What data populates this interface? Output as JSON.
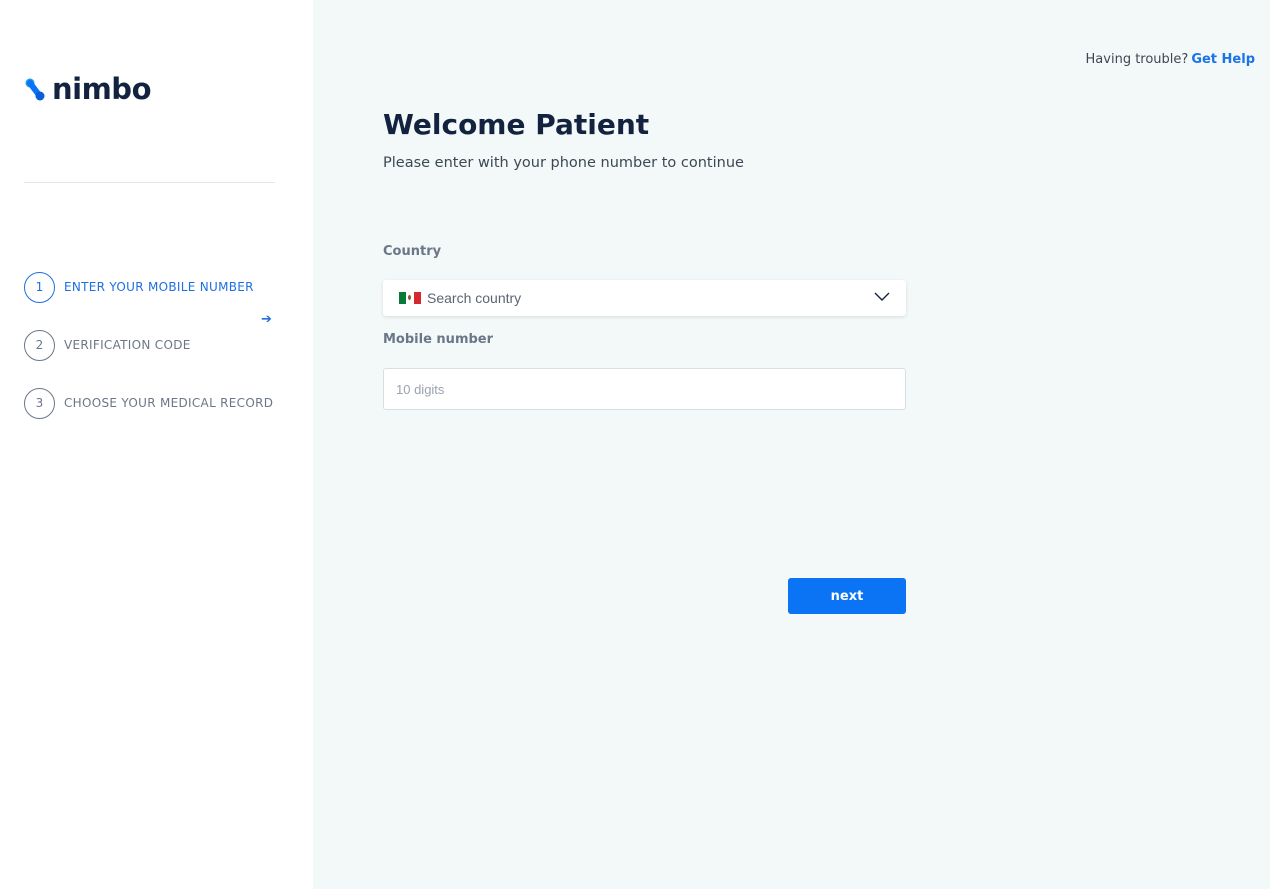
{
  "brand": {
    "name": "nimbo",
    "accent": "#0a74f5",
    "dark": "#13233f"
  },
  "help": {
    "prefix": "Having trouble?",
    "link": "Get Help"
  },
  "steps": [
    {
      "number": "1",
      "label": "ENTER YOUR MOBILE NUMBER",
      "active": true
    },
    {
      "number": "2",
      "label": "VERIFICATION CODE",
      "active": false
    },
    {
      "number": "3",
      "label": "CHOOSE YOUR MEDICAL RECORD",
      "active": false
    }
  ],
  "main": {
    "title": "Welcome Patient",
    "subtitle": "Please enter with your phone number to continue",
    "country_label": "Country",
    "country_placeholder": "Search country",
    "country_flag": "mexico-flag-icon",
    "mobile_label": "Mobile number",
    "mobile_placeholder": "10 digits",
    "next_label": "next"
  }
}
